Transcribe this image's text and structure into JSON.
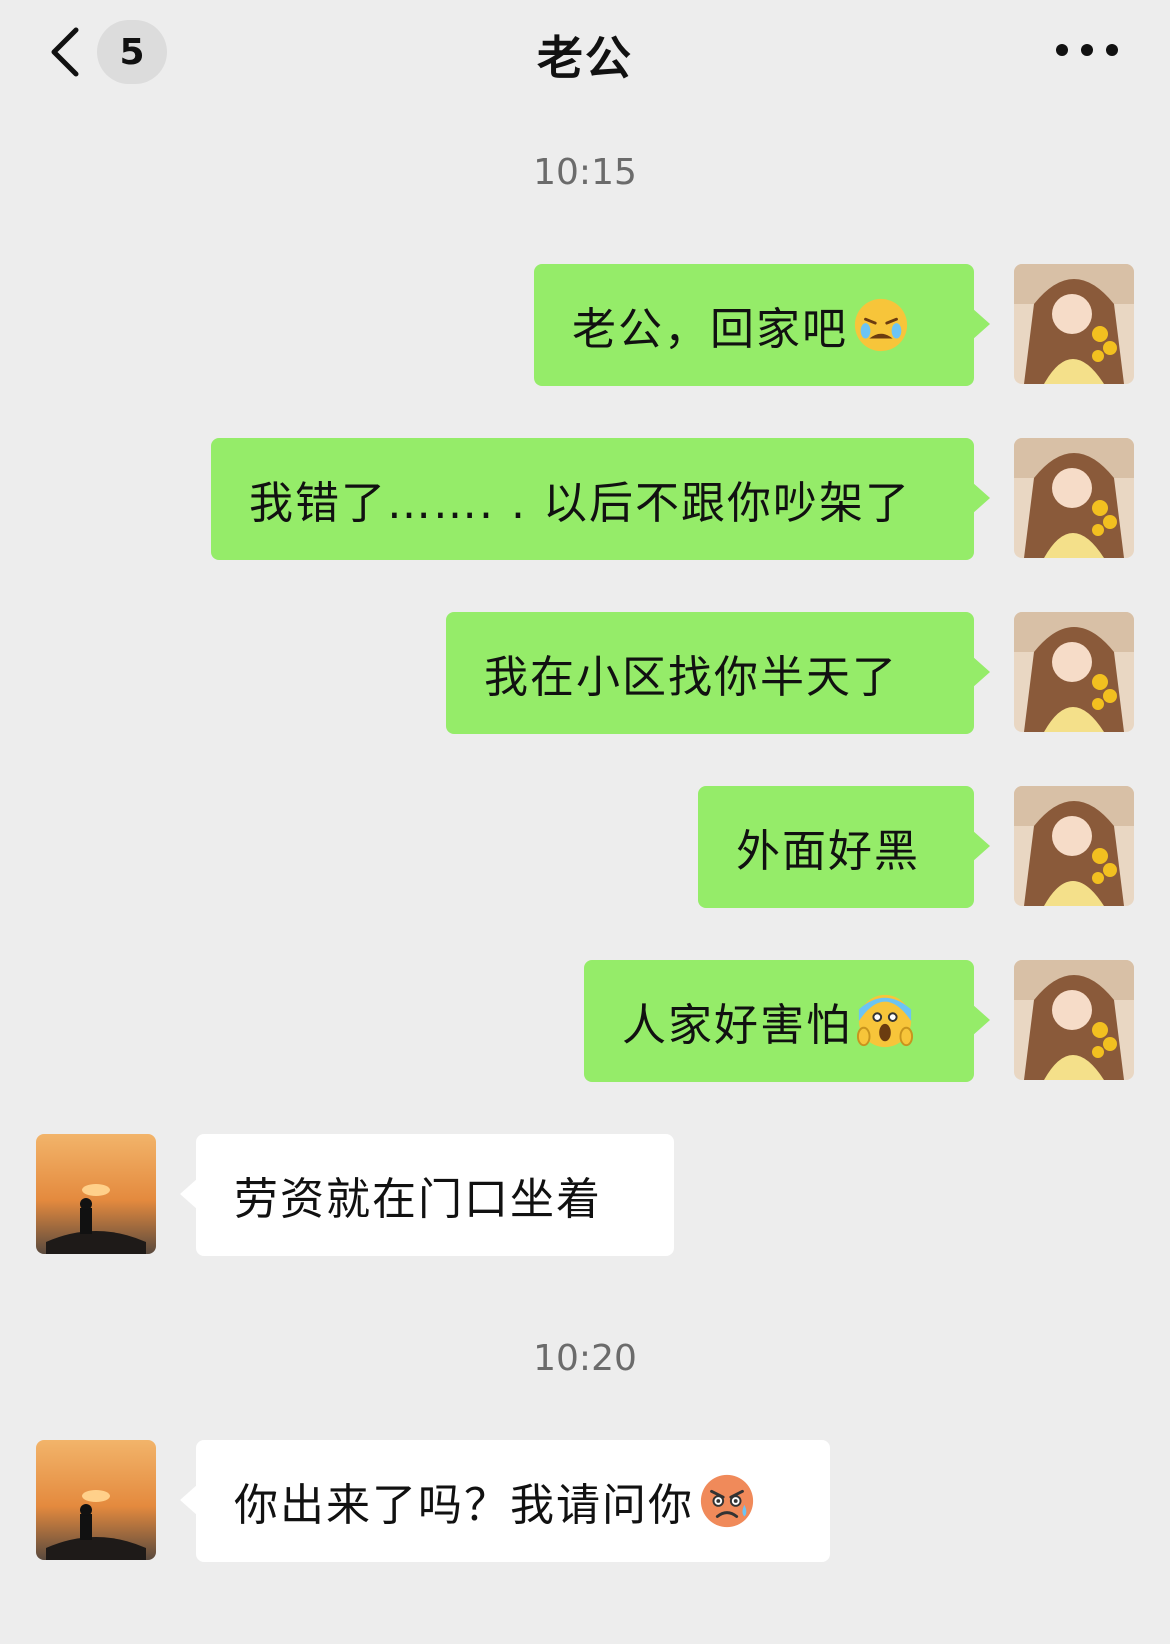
{
  "header": {
    "title": "老公",
    "unread_count": "5",
    "back_icon": "chevron-left-icon",
    "more_icon": "more-horizontal-icon"
  },
  "timestamps": [
    "10:15",
    "10:20"
  ],
  "messages": [
    {
      "sender": "me",
      "text": "老公，回家吧",
      "emoji": "crying-face"
    },
    {
      "sender": "me",
      "text": "我错了……. . 以后不跟你吵架了"
    },
    {
      "sender": "me",
      "text": "我在小区找你半天了"
    },
    {
      "sender": "me",
      "text": "外面好黑"
    },
    {
      "sender": "me",
      "text": "人家好害怕",
      "emoji": "screaming-face"
    },
    {
      "sender": "other",
      "text": "劳资就在门口坐着"
    },
    {
      "sender": "other",
      "text": "你出来了吗？我请问你",
      "emoji": "angry-sweat-face"
    }
  ],
  "colors": {
    "background": "#ededed",
    "sent_bubble": "#95ec69",
    "received_bubble": "#ffffff",
    "timestamp_text": "#6b6b6b"
  }
}
